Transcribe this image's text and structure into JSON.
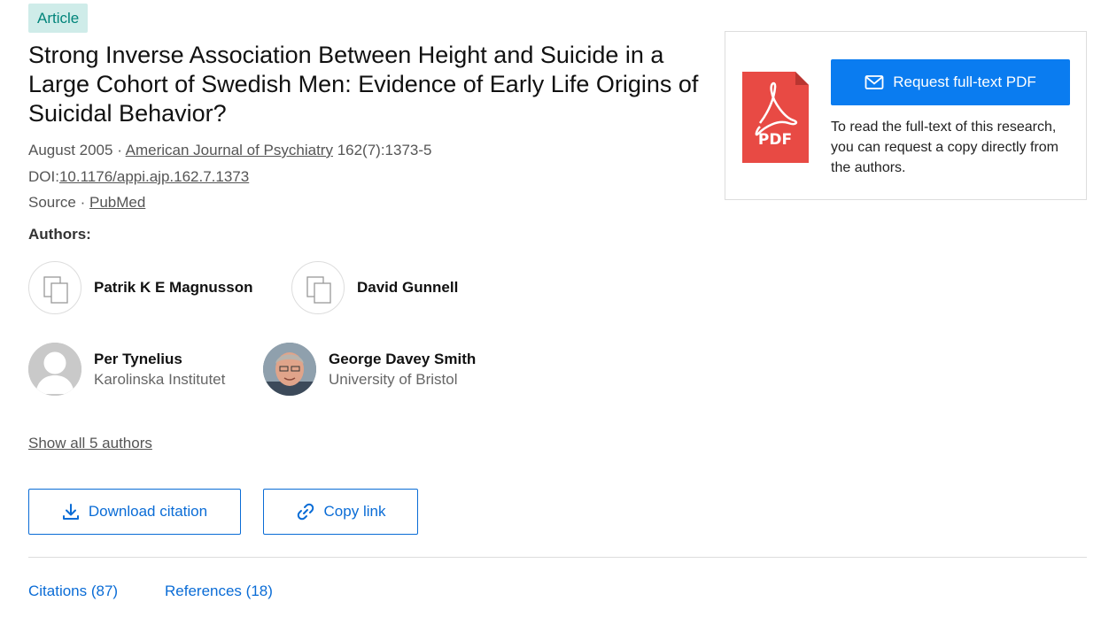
{
  "badge": "Article",
  "title": "Strong Inverse Association Between Height and Suicide in a Large Cohort of Swedish Men: Evidence of Early Life Origins of Suicidal Behavior?",
  "meta": {
    "date": "August 2005",
    "sep1": " · ",
    "journal": "American Journal of Psychiatry",
    "issue": " 162(7):1373-5",
    "doi_label": "DOI:",
    "doi": "10.1176/appi.ajp.162.7.1373",
    "source_label": "Source",
    "sep2": " · ",
    "source": "PubMed"
  },
  "authors_label": "Authors:",
  "authors": [
    {
      "name": "Patrik K E Magnusson",
      "institution": ""
    },
    {
      "name": "David Gunnell",
      "institution": ""
    },
    {
      "name": "Per Tynelius",
      "institution": "Karolinska Institutet"
    },
    {
      "name": "George Davey Smith",
      "institution": "University of Bristol"
    }
  ],
  "show_all": "Show all 5 authors",
  "buttons": {
    "download_citation": "Download citation",
    "copy_link": "Copy link"
  },
  "tabs": {
    "citations": "Citations (87)",
    "references": "References (18)"
  },
  "panel": {
    "pdf_label": "PDF",
    "request_button": "Request full-text PDF",
    "text": "To read the full-text of this research, you can request a copy directly from the authors."
  },
  "colors": {
    "accent": "#0a6cd6",
    "request_button": "#0a7cf0",
    "badge_bg": "#cfece9",
    "badge_text": "#00847a",
    "pdf_red": "#e84a44"
  }
}
